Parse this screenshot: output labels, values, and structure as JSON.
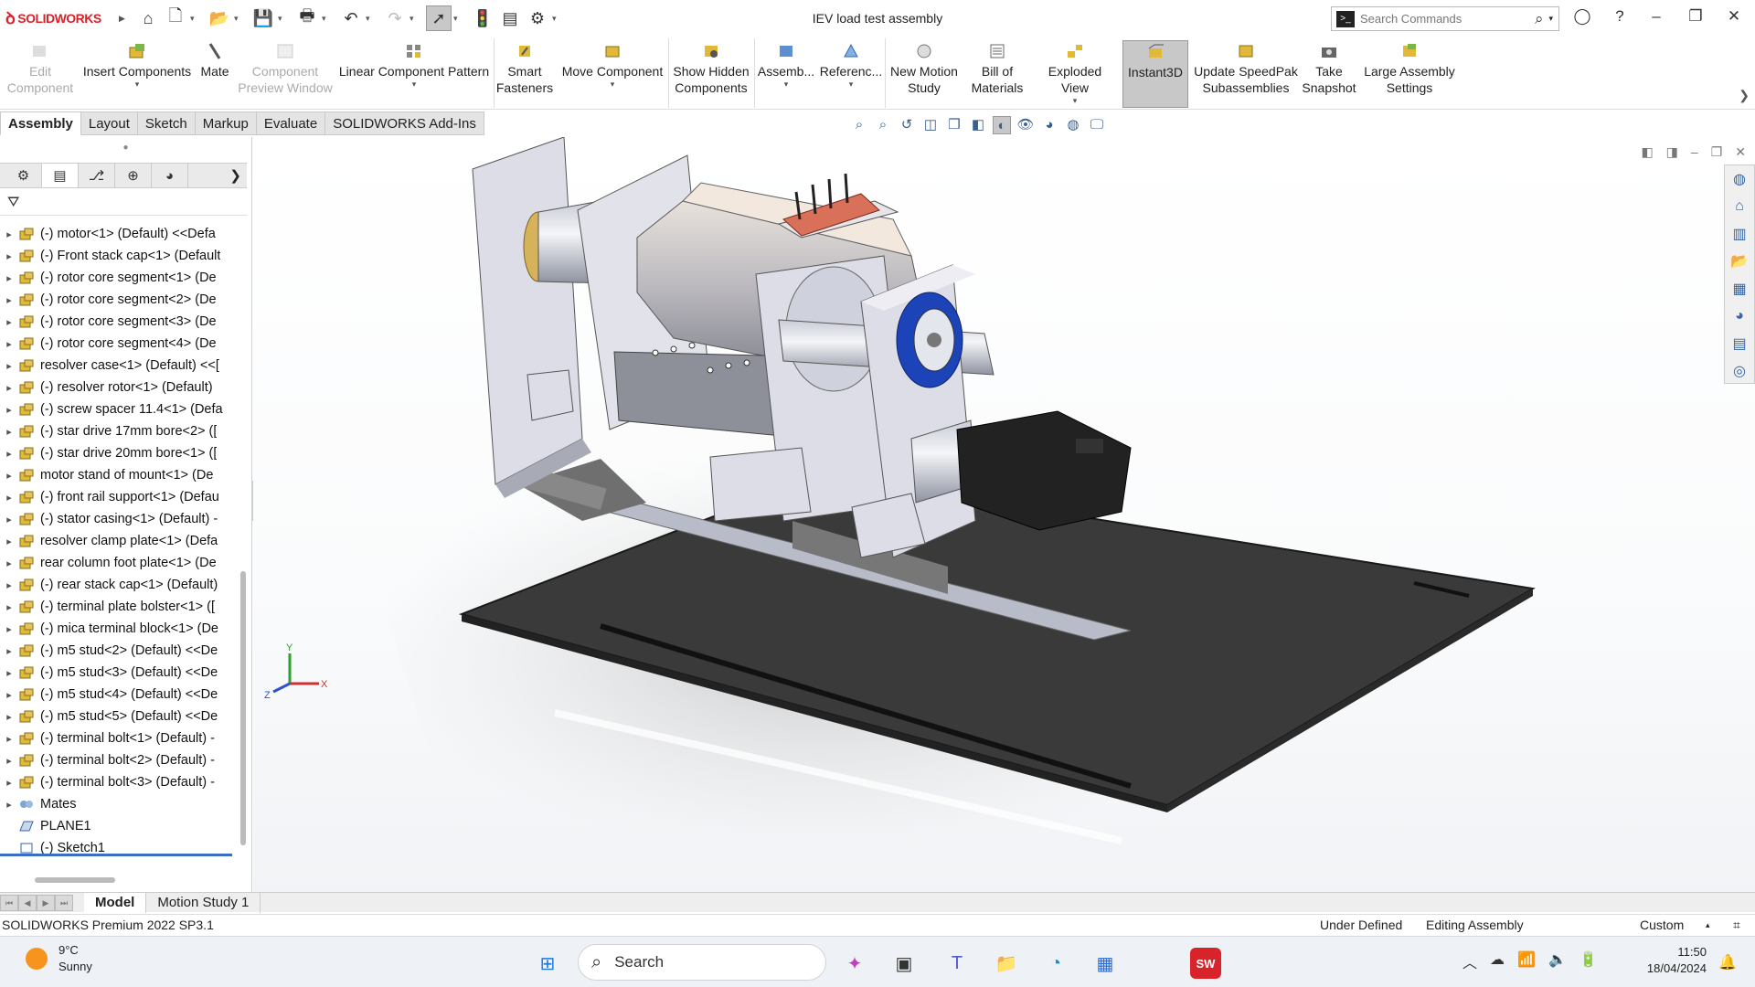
{
  "app": {
    "brand": "SOLIDWORKS",
    "doc_title": "IEV load test assembly"
  },
  "search": {
    "placeholder": "Search Commands"
  },
  "ribbon": [
    {
      "label": "Edit Component",
      "state": "disabled",
      "icon": "edit-component-icon"
    },
    {
      "label": "Insert Components",
      "state": "normal",
      "icon": "insert-components-icon"
    },
    {
      "label": "Mate",
      "state": "normal",
      "icon": "mate-icon"
    },
    {
      "label": "Component Preview Window",
      "state": "disabled",
      "icon": "preview-window-icon"
    },
    {
      "label": "Linear Component Pattern",
      "state": "normal",
      "icon": "linear-pattern-icon"
    },
    {
      "label": "Smart Fasteners",
      "state": "normal",
      "icon": "smart-fasteners-icon"
    },
    {
      "label": "Move Component",
      "state": "normal",
      "icon": "move-component-icon"
    },
    {
      "label": "Show Hidden Components",
      "state": "normal",
      "icon": "show-hidden-icon"
    },
    {
      "label": "Assemb...",
      "state": "normal",
      "icon": "assembly-features-icon"
    },
    {
      "label": "Referenc...",
      "state": "normal",
      "icon": "reference-geometry-icon"
    },
    {
      "label": "New Motion Study",
      "state": "normal",
      "icon": "motion-study-icon"
    },
    {
      "label": "Bill of Materials",
      "state": "normal",
      "icon": "bom-icon"
    },
    {
      "label": "Exploded View",
      "state": "normal",
      "icon": "exploded-view-icon"
    },
    {
      "label": "Instant3D",
      "state": "active",
      "icon": "instant3d-icon"
    },
    {
      "label": "Update SpeedPak Subassemblies",
      "state": "normal",
      "icon": "speedpak-icon"
    },
    {
      "label": "Take Snapshot",
      "state": "normal",
      "icon": "camera-icon"
    },
    {
      "label": "Large Assembly Settings",
      "state": "normal",
      "icon": "large-assembly-icon"
    }
  ],
  "command_tabs": [
    "Assembly",
    "Layout",
    "Sketch",
    "Markup",
    "Evaluate",
    "SOLIDWORKS Add-Ins"
  ],
  "active_tab": "Assembly",
  "tree": [
    "(-) motor<1> (Default) <<Defa",
    "(-) Front stack cap<1> (Default",
    "(-) rotor core segment<1> (De",
    "(-) rotor core segment<2> (De",
    "(-) rotor core segment<3> (De",
    "(-) rotor core segment<4> (De",
    "resolver case<1> (Default) <<[",
    "(-) resolver rotor<1> (Default)",
    "(-) screw spacer 11.4<1> (Defa",
    "(-) star drive 17mm bore<2> ([",
    "(-) star drive 20mm bore<1> ([",
    "motor stand of mount<1> (De",
    "(-) front rail support<1> (Defau",
    "(-) stator casing<1> (Default) -",
    "resolver clamp plate<1> (Defa",
    "rear column foot plate<1> (De",
    "(-) rear stack cap<1> (Default)",
    "(-) terminal plate bolster<1> ([",
    "(-) mica terminal block<1> (De",
    "(-) m5 stud<2> (Default) <<De",
    "(-) m5 stud<3> (Default) <<De",
    "(-) m5 stud<4> (Default) <<De",
    "(-) m5 stud<5> (Default) <<De",
    "(-) terminal bolt<1> (Default) -",
    "(-) terminal bolt<2> (Default) -",
    "(-) terminal bolt<3> (Default) -"
  ],
  "tree_tail": {
    "mates": "Mates",
    "plane": "PLANE1",
    "sketch": "(-) Sketch1"
  },
  "triad": {
    "x": "X",
    "y": "Y",
    "z": "Z"
  },
  "model_tabs": [
    "Model",
    "Motion Study 1"
  ],
  "status": {
    "version": "SOLIDWORKS Premium 2022 SP3.1",
    "definition": "Under Defined",
    "mode": "Editing Assembly",
    "units": "Custom"
  },
  "taskbar": {
    "temp": "9°C",
    "condition": "Sunny",
    "search": "Search",
    "time": "11:50",
    "date": "18/04/2024"
  },
  "colors": {
    "accent": "#3a6fc7",
    "brand": "#d8232a",
    "active_btn": "#c8c8c8"
  }
}
